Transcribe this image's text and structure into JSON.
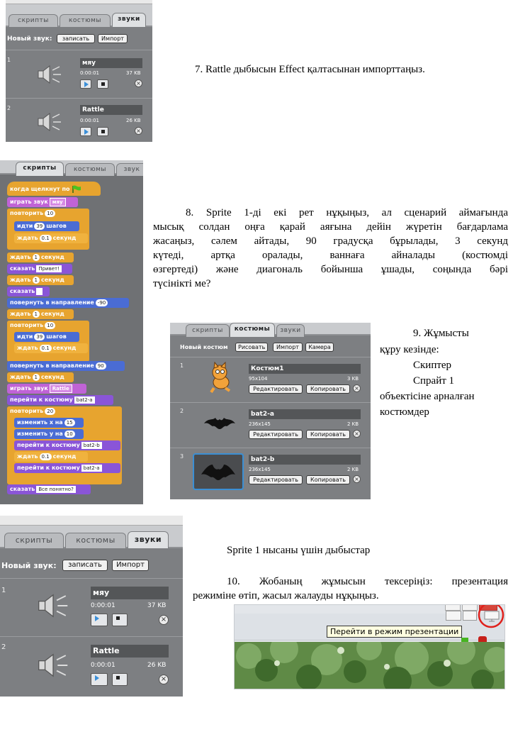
{
  "panel1": {
    "tabs": [
      "скрипты",
      "костюмы",
      "звуки"
    ],
    "new_sound_label": "Новый звук:",
    "record_button": "записать",
    "import_button": "Импорт",
    "sounds": [
      {
        "num": "1",
        "name": "мяу",
        "time": "0:00:01",
        "size": "37 KB"
      },
      {
        "num": "2",
        "name": "Rattle",
        "time": "0:00:01",
        "size": "26 KB"
      }
    ]
  },
  "step7": "7. Rattle дыбысын Effect қалтасынан импорттаңыз.",
  "panel2": {
    "tabs": [
      "скрипты",
      "костюмы",
      "звук"
    ],
    "blocks": {
      "when_flag": "когда щелкнут по",
      "play_sound": "играть звук",
      "play_sound_arg": "мяу",
      "repeat1": "повторить",
      "repeat1_arg": "10",
      "move1": "идти",
      "move1_arg": "39",
      "move1_suffix": "шагов",
      "wait1": "ждать",
      "wait1_arg": "0.1",
      "wait1_suffix": "секунд",
      "wait2": "ждать",
      "wait2_arg": "1",
      "wait2_suffix": "секунд",
      "say1": "сказать",
      "say1_arg": "Привет!",
      "wait3": "ждать",
      "wait3_arg": "1",
      "wait3_suffix": "секунд",
      "say2": "сказать",
      "turn1": "повернуть в направление",
      "turn1_arg": "-90",
      "wait4": "ждать",
      "wait4_arg": "1",
      "wait4_suffix": "секунд",
      "repeat2": "повторить",
      "repeat2_arg": "10",
      "move2": "идти",
      "move2_arg": "39",
      "move2_suffix": "шагов",
      "wait5": "ждать",
      "wait5_arg": "0.1",
      "wait5_suffix": "секунд",
      "turn2": "повернуть в направление",
      "turn2_arg": "90",
      "wait6": "ждать",
      "wait6_arg": "1",
      "wait6_suffix": "секунд",
      "play_sound2": "играть звук",
      "play_sound2_arg": "Rattle",
      "switch1": "перейти к костюму",
      "switch1_arg": "bat2-a",
      "repeat3": "повторить",
      "repeat3_arg": "20",
      "changex": "изменить x на",
      "changex_arg": "15",
      "changey": "изменить у на",
      "changey_arg": "10",
      "switch2": "перейти к костюму",
      "switch2_arg": "bat2-b",
      "wait7": "ждать",
      "wait7_arg": "0.1",
      "wait7_suffix": "секунд",
      "switch3": "перейти к костюму",
      "switch3_arg": "bat2-a",
      "say3": "сказать",
      "say3_arg": "Все понятно?"
    }
  },
  "step8": {
    "l1": "8. Sprite 1-ді екі рет нұқыңыз, ал сценарий аймағында",
    "l2": "мысық солдан оңға қарай аяғына дейін жүретін бағдарлама",
    "l3": "жасаңыз, сәлем айтады, 90 градусқа бұрылады, 3 секунд",
    "l4": "күтеді, артқа оралады, ваннаға айналады (костюмді",
    "l5": "өзгертеді) және диагональ бойынша ұшады, соңында бәрі",
    "l6": "түсінікті ме?"
  },
  "panel3": {
    "tabs": [
      "скрипты",
      "костюмы",
      "звуки"
    ],
    "new_costume_label": "Новый костюм",
    "paint_button": "Рисовать",
    "import_button": "Импорт",
    "camera_button": "Камера",
    "edit_button": "Редактировать",
    "copy_button": "Копировать",
    "costumes": [
      {
        "num": "1",
        "name": "Костюм1",
        "dims": "95x104",
        "size": "3 KB"
      },
      {
        "num": "2",
        "name": "bat2-a",
        "dims": "236x145",
        "size": "2 KB"
      },
      {
        "num": "3",
        "name": "bat2-b",
        "dims": "236x145",
        "size": "2 KB"
      }
    ]
  },
  "step9": {
    "l1": "9. Жұмысты",
    "l2": "құру кезінде:",
    "l3": "Скиптер",
    "l4": "Спрайт 1",
    "l5": "объектісіне арналған",
    "l6": "костюмдер"
  },
  "panel4": {
    "tabs": [
      "скрипты",
      "костюмы",
      "звуки"
    ],
    "new_sound_label": "Новый звук:",
    "record_button": "записать",
    "import_button": "Импорт",
    "sounds": [
      {
        "num": "1",
        "name": "мяу",
        "time": "0:00:01",
        "size": "37 KB"
      },
      {
        "num": "2",
        "name": "Rattle",
        "time": "0:00:01",
        "size": "26 KB"
      }
    ]
  },
  "caption_sounds": "Sprite 1 нысаны үшін дыбыстар",
  "step10": {
    "l1": "10. Жобаның жұмысын тексеріңіз: презентация",
    "l2": "режиміне өтіп, жасыл жалауды нұқыңыз."
  },
  "presentation_tooltip": "Перейти в режим презентации"
}
